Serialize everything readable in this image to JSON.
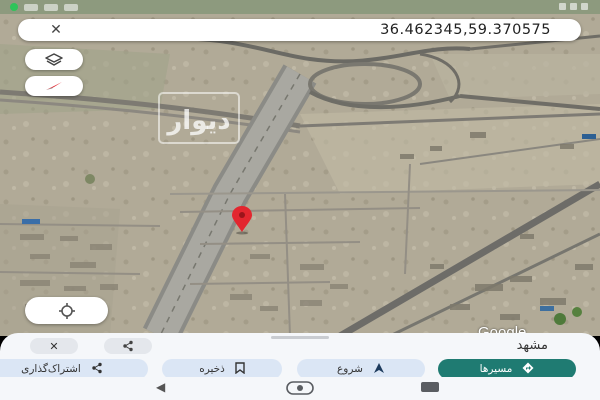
{
  "search": {
    "coordinates": "36.462345,59.370575",
    "close_icon": "close-icon"
  },
  "map": {
    "google_logo": "Google",
    "watermark_text": "دیوار",
    "pin_icon": "location-pin-icon"
  },
  "controls": {
    "layers_icon": "layers-icon",
    "compass_icon": "compass-icon",
    "locate_icon": "my-location-icon"
  },
  "sheet": {
    "place_name": "مشهد",
    "close_icon": "close-icon",
    "share_icon": "share-icon",
    "actions": [
      {
        "label": "مسیرها",
        "icon": "directions-icon"
      },
      {
        "label": "شروع",
        "icon": "navigation-arrow-icon"
      },
      {
        "label": "ذخیره",
        "icon": "bookmark-icon"
      },
      {
        "label": "اشتراک‌گذاری",
        "icon": "share-icon"
      }
    ]
  },
  "colors": {
    "primary": "#1f7b72",
    "chip": "#dbe6f5",
    "pin": "#e3262f"
  }
}
